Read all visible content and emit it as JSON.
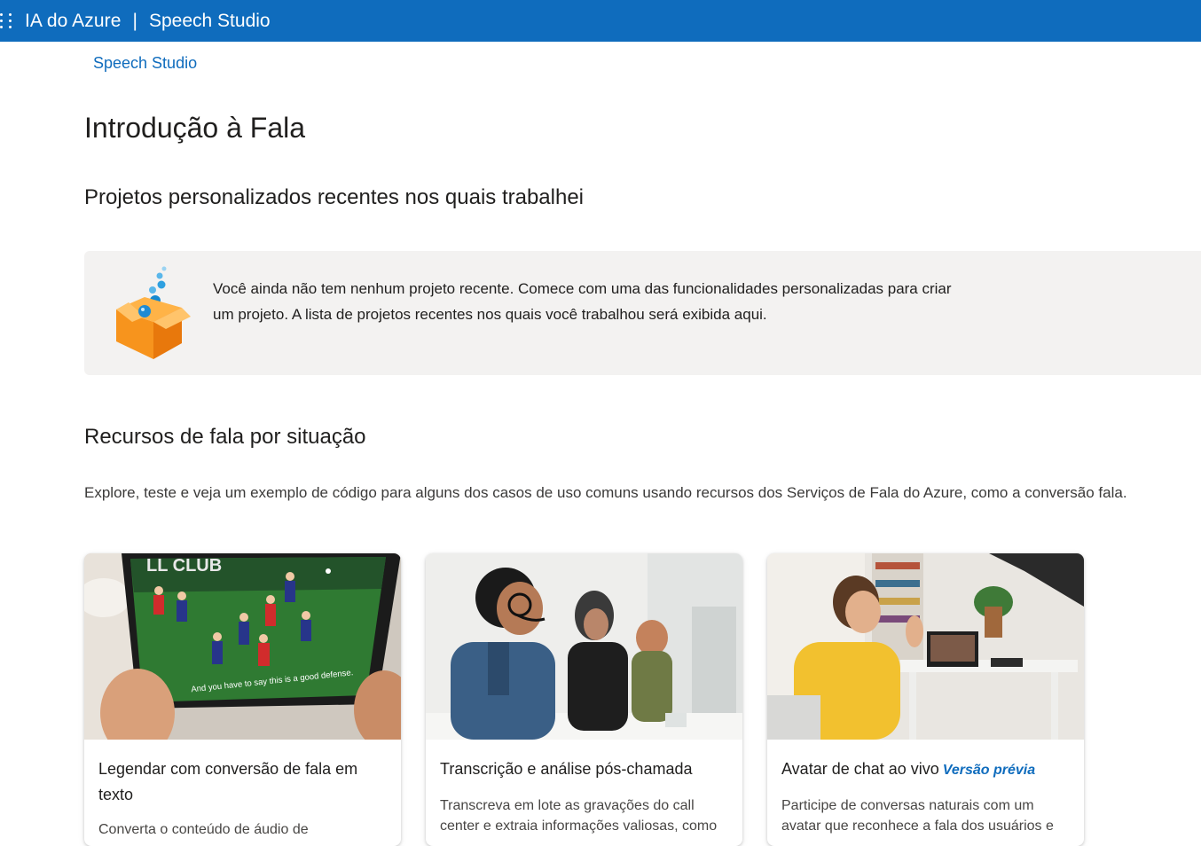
{
  "topbar": {
    "brand": "IA do Azure",
    "separator": "|",
    "product": "Speech Studio",
    "waffle_icon": "waffle-icon",
    "color": "#0f6cbd"
  },
  "breadcrumb": "Speech Studio",
  "page_title": "Introdução à Fala",
  "recent": {
    "title": "Projetos personalizados recentes nos quais trabalhei",
    "empty_icon": "box-bubbles-icon",
    "empty_text": "Você ainda não tem nenhum projeto recente. Comece com uma das funcionalidades personalizadas para criar um projeto. A lista de projetos recentes nos quais você trabalhou será exibida aqui."
  },
  "scenarios": {
    "title": "Recursos de fala por situação",
    "description": "Explore, teste e veja um exemplo de código para alguns dos casos de uso comuns usando recursos dos Serviços de Fala do Azure, como a conversão fala.",
    "cards": [
      {
        "title": "Legendar com conversão de fala em texto",
        "description": "Converta o conteúdo de áudio de",
        "image_caption": "And you have to say this is a good defense."
      },
      {
        "title": "Transcrição e análise pós-chamada",
        "description": "Transcreva em lote as gravações do call center e extraia informações valiosas, como"
      },
      {
        "title": "Avatar de chat ao vivo",
        "badge": "Versão prévia",
        "description": "Participe de conversas naturais com um avatar que reconhece a fala dos usuários e"
      }
    ]
  }
}
